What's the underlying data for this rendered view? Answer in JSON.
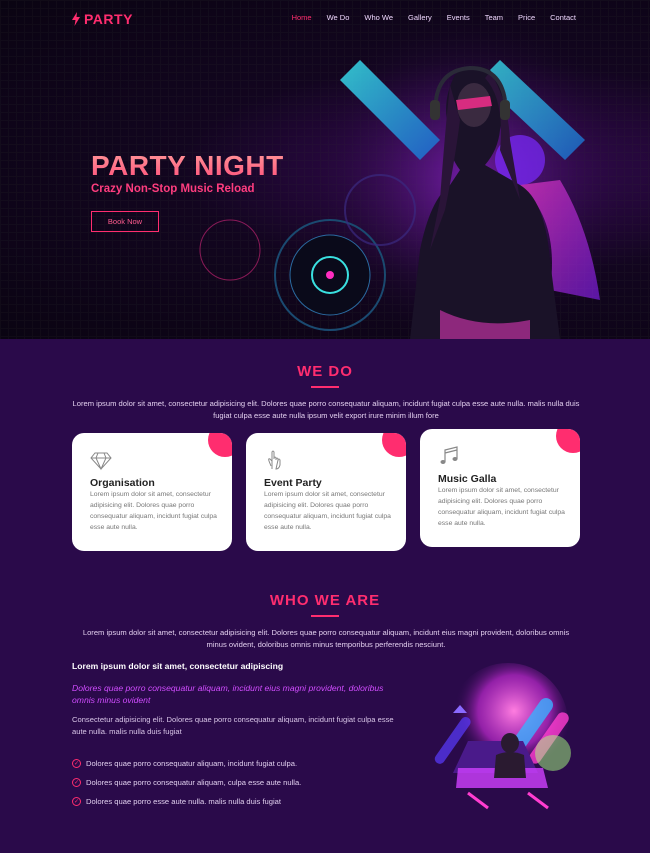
{
  "nav": {
    "logo": "PARTY",
    "links": [
      "Home",
      "We Do",
      "Who We",
      "Gallery",
      "Events",
      "Team",
      "Price",
      "Contact"
    ],
    "active": "Home"
  },
  "hero": {
    "title": "PARTY NIGHT",
    "subtitle": "Crazy Non-Stop Music Reload",
    "button": "Book Now"
  },
  "we_do": {
    "title": "WE DO",
    "intro": "Lorem ipsum dolor sit amet, consectetur adipisicing elit. Dolores quae porro consequatur aliquam, incidunt fugiat culpa esse aute nulla. malis nulla duis fugiat culpa esse aute nulla ipsum velit export irure minim illum fore",
    "cards": [
      {
        "icon": "diamond-icon",
        "title": "Organisation",
        "text": "Lorem ipsum dolor sit amet, consectetur adipisicing elit. Dolores quae porro consequatur aliquam, incidunt fugiat culpa esse aute nulla."
      },
      {
        "icon": "hand-pointer-icon",
        "title": "Event Party",
        "text": "Lorem ipsum dolor sit amet, consectetur adipisicing elit. Dolores quae porro consequatur aliquam, incidunt fugiat culpa esse aute nulla."
      },
      {
        "icon": "music-note-icon",
        "title": "Music Galla",
        "text": "Lorem ipsum dolor sit amet, consectetur adipisicing elit. Dolores quae porro consequatur aliquam, incidunt fugiat culpa esse aute nulla."
      }
    ]
  },
  "who_we_are": {
    "title": "WHO WE ARE",
    "intro": "Lorem ipsum dolor sit amet, consectetur adipisicing elit. Dolores quae porro consequatur aliquam, incidunt eius magni provident, doloribus omnis minus ovident, doloribus omnis minus temporibus perferendis nesciunt.",
    "heading": "Lorem ipsum dolor sit amet, consectetur adipiscing",
    "italic": "Dolores quae porro consequatur aliquam, incidunt eius magni provident, doloribus omnis minus ovident",
    "paragraph": "Consectetur adipisicing elit. Dolores quae porro consequatur aliquam, incidunt fugiat culpa esse aute nulla. malis nulla duis fugiat",
    "checklist": [
      "Dolores quae porro consequatur aliquam, incidunt fugiat culpa.",
      "Dolores quae porro consequatur aliquam, culpa esse aute nulla.",
      "Dolores quae porro esse aute nulla. malis nulla duis fugiat"
    ]
  },
  "colors": {
    "accent": "#ff2d6f",
    "background": "#2a0a4a",
    "hero_bg": "#0a0412",
    "card_bg": "#ffffff",
    "italic_text": "#d14dff"
  }
}
